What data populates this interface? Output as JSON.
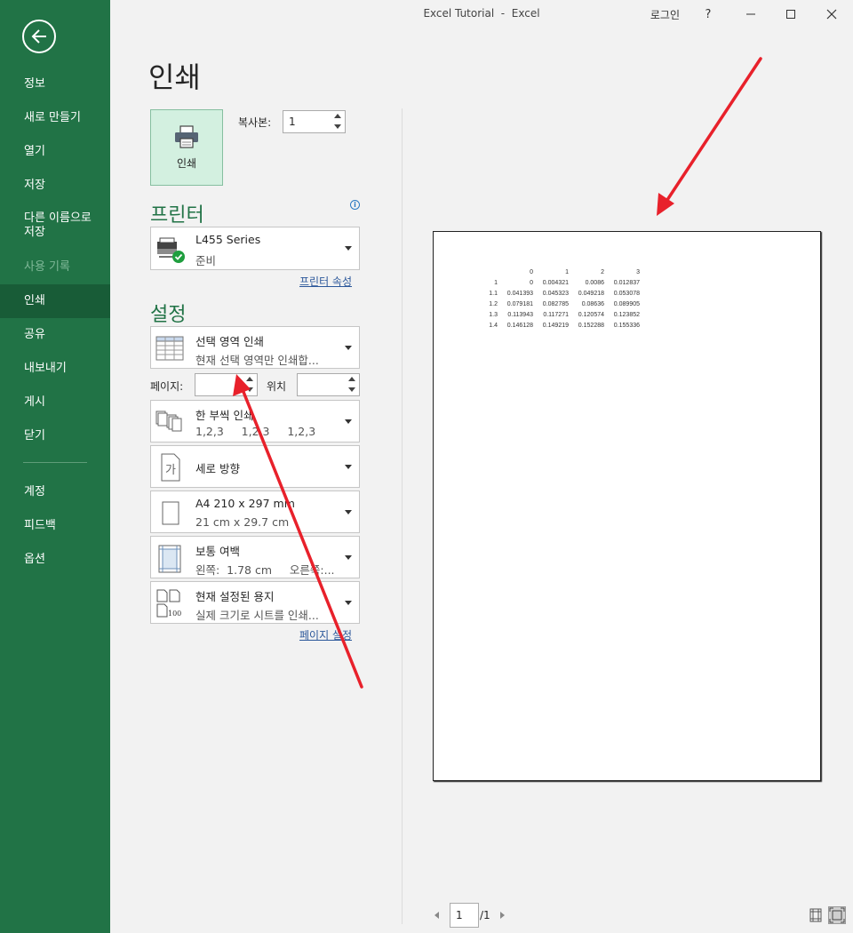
{
  "window": {
    "title": "Excel Tutorial  -  Excel",
    "login": "로그인",
    "help": "?",
    "minimize_icon": "minimize-icon",
    "maximize_icon": "maximize-icon",
    "close_icon": "close-icon"
  },
  "sidebar": {
    "back_icon": "back-arrow-icon",
    "items": [
      {
        "label": "정보"
      },
      {
        "label": "새로 만들기"
      },
      {
        "label": "열기"
      },
      {
        "label": "저장"
      },
      {
        "label": "다른 이름으로\n저장"
      },
      {
        "label": "사용 기록",
        "disabled": true
      },
      {
        "label": "인쇄",
        "active": true
      },
      {
        "label": "공유"
      },
      {
        "label": "내보내기"
      },
      {
        "label": "게시"
      },
      {
        "label": "닫기"
      }
    ],
    "bottom_items": [
      {
        "label": "계정"
      },
      {
        "label": "피드백"
      },
      {
        "label": "옵션"
      }
    ],
    "colors": {
      "background": "#217346",
      "active": "#185c37"
    }
  },
  "main": {
    "title": "인쇄",
    "print_button": "인쇄",
    "copies_label": "복사본:",
    "copies_value": "1",
    "printer_section": "프린터",
    "printer": {
      "name": "L455 Series",
      "status": "준비"
    },
    "printer_properties_link": "프린터 속성",
    "settings_section": "설정",
    "settings": {
      "print_what": {
        "l1": "선택 영역 인쇄",
        "l2": "현재 선택 영역만 인쇄합..."
      },
      "pages_label": "페이지:",
      "pages_value": "",
      "to_label": "위치",
      "to_value": "",
      "collate": {
        "l1": "한 부씩 인쇄",
        "l2": "1,2,3     1,2,3     1,2,3"
      },
      "orientation": {
        "l1": "세로 방향"
      },
      "paper": {
        "l1": "A4 210 x 297 mm",
        "l2": "21 cm x 29.7 cm"
      },
      "margins": {
        "l1": "보통 여백",
        "l2": "왼쪽:  1.78 cm     오른쪽:..."
      },
      "scaling": {
        "l1": "현재 설정된 용지",
        "l2": "실제 크기로 시트를 인쇄..."
      }
    },
    "page_setup_link": "페이지 설정"
  },
  "preview": {
    "table": [
      [
        "",
        "0",
        "1",
        "2",
        "3"
      ],
      [
        "1",
        "0",
        "0.004321",
        "0.0086",
        "0.012837"
      ],
      [
        "1.1",
        "0.041393",
        "0.045323",
        "0.049218",
        "0.053078"
      ],
      [
        "1.2",
        "0.079181",
        "0.082785",
        "0.08636",
        "0.089905"
      ],
      [
        "1.3",
        "0.113943",
        "0.117271",
        "0.120574",
        "0.123852"
      ],
      [
        "1.4",
        "0.146128",
        "0.149219",
        "0.152288",
        "0.155336"
      ]
    ],
    "current_page": "1",
    "total_pages": "/1"
  }
}
